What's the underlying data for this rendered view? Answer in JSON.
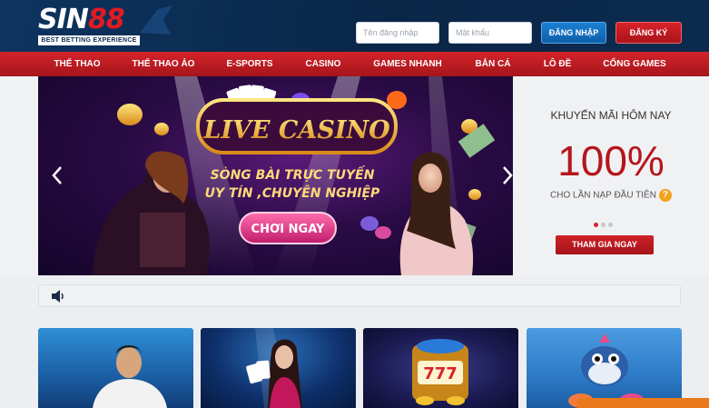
{
  "header": {
    "logo_text_a": "SIN",
    "logo_text_b": "88",
    "logo_tagline": "BEST BETTING EXPERIENCE",
    "username_placeholder": "Tên đăng nhập",
    "password_placeholder": "Mật khẩu",
    "login_label": "ĐĂNG NHẬP",
    "register_label": "ĐĂNG KÝ"
  },
  "nav": {
    "items": [
      {
        "label": "THỂ THAO"
      },
      {
        "label": "THỂ THAO ẢO"
      },
      {
        "label": "E-SPORTS"
      },
      {
        "label": "CASINO"
      },
      {
        "label": "GAMES NHANH"
      },
      {
        "label": "BẮN CÁ"
      },
      {
        "label": "LÔ ĐỀ"
      },
      {
        "label": "CỔNG GAMES"
      }
    ]
  },
  "banner": {
    "headline": "LIVE CASINO",
    "tagline_line1": "SÒNG BÀI TRỰC TUYẾN",
    "tagline_line2": "UY TÍN ,CHUYÊN NGHIỆP",
    "cta_label": "CHƠI NGAY",
    "slide_count": 3,
    "active_slide": 1
  },
  "promo": {
    "title": "KHUYẾN MÃI HÔM NAY",
    "amount": "100%",
    "subtitle": "CHO LẦN NẠP ĐẦU TIÊN",
    "help_glyph": "?",
    "join_label": "THAM GIA NGAY"
  },
  "colors": {
    "header_bg": "#0c2b4f",
    "nav_red": "#c81e24",
    "promo_red": "#b4161c",
    "login_blue": "#1b7fd3",
    "orange": "#e9791b"
  },
  "icons": {
    "sound": "speaker-icon",
    "prev": "chevron-left-icon",
    "next": "chevron-right-icon"
  }
}
